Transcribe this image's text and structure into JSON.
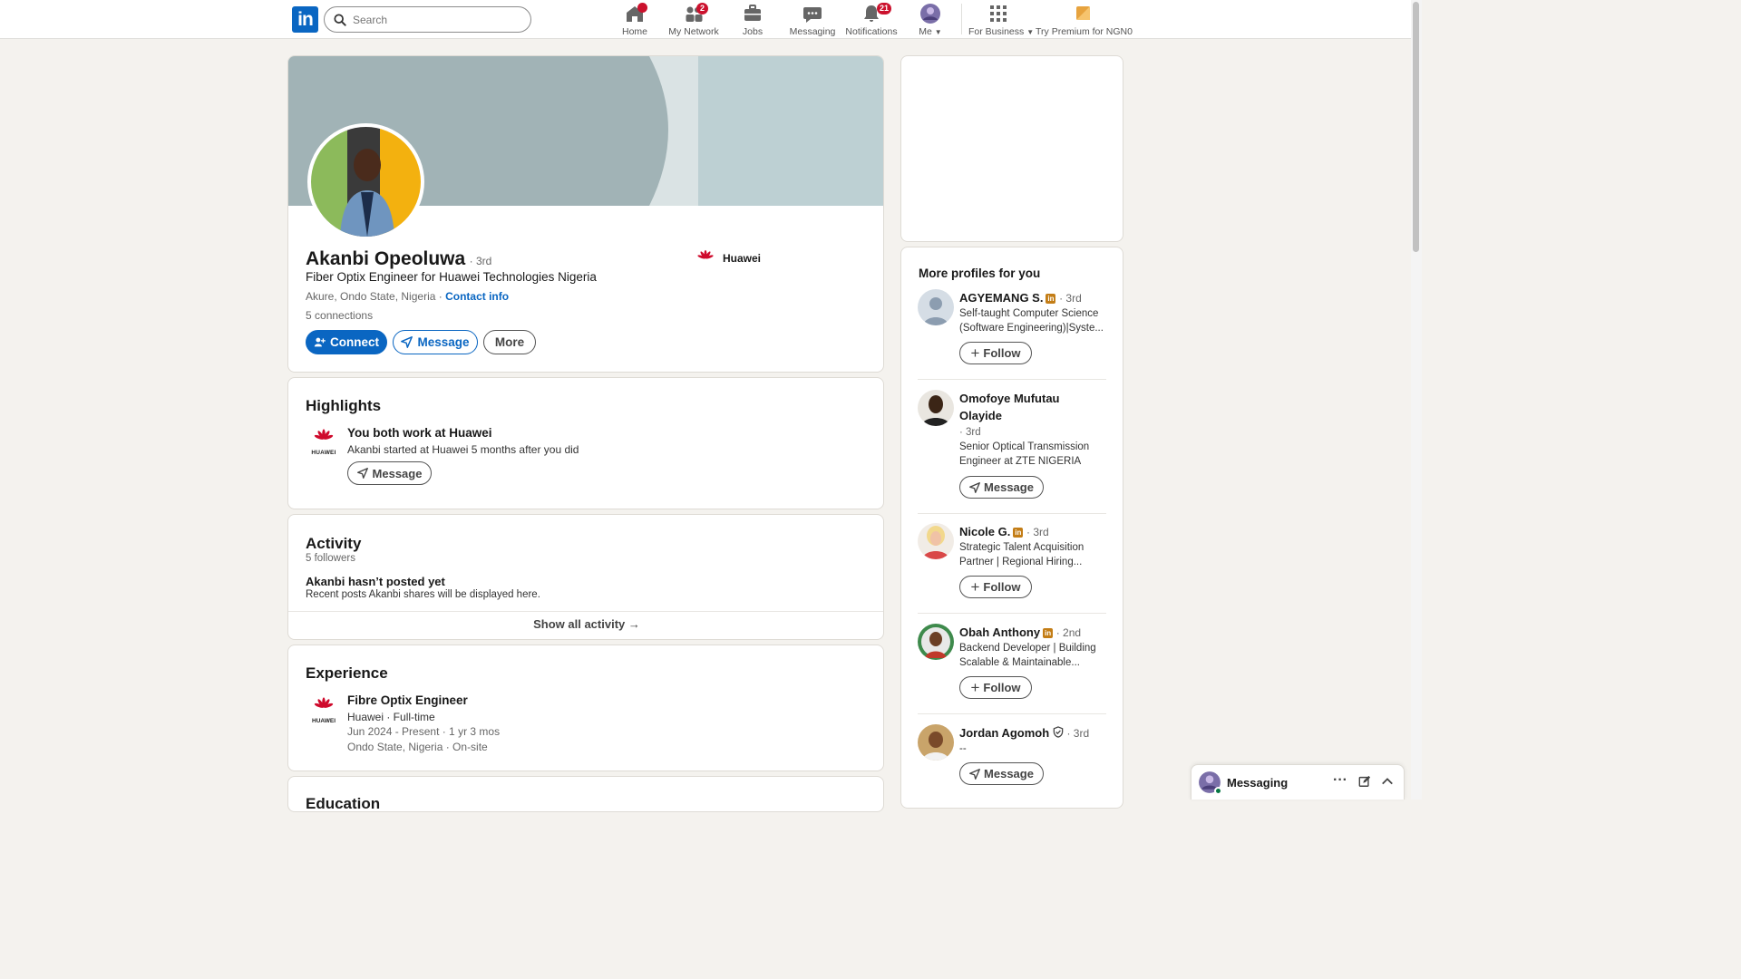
{
  "nav": {
    "search_placeholder": "Search",
    "items": [
      {
        "label": "Home",
        "badge": ""
      },
      {
        "label": "My Network",
        "badge": "2"
      },
      {
        "label": "Jobs",
        "badge": ""
      },
      {
        "label": "Messaging",
        "badge": ""
      },
      {
        "label": "Notifications",
        "badge": "21"
      },
      {
        "label": "Me"
      },
      {
        "label": "For Business"
      },
      {
        "label": "Try Premium for NGN0"
      }
    ],
    "logo": "in"
  },
  "profile": {
    "name": "Akanbi Opeoluwa",
    "degree": "· 3rd",
    "headline": "Fiber Optix Engineer for Huawei Technologies Nigeria",
    "location": "Akure, Ondo State, Nigeria ·",
    "contact_info": "Contact info",
    "connections_count": "5",
    "connections_label": "connections",
    "company": "Huawei",
    "buttons": {
      "connect": "Connect",
      "message": "Message",
      "more": "More"
    }
  },
  "highlights": {
    "title": "Highlights",
    "item_title": "You both work at Huawei",
    "item_desc": "Akanbi started at Huawei 5 months after you did",
    "button": "Message",
    "logo_text": "HUAWEI"
  },
  "activity": {
    "title": "Activity",
    "followers": "5 followers",
    "empty_title": "Akanbi hasn’t posted yet",
    "empty_desc": "Recent posts Akanbi shares will be displayed here.",
    "show_all": "Show all activity"
  },
  "experience": {
    "title": "Experience",
    "role": "Fibre Optix Engineer",
    "company_line": "Huawei · Full-time",
    "dates": "Jun 2024 - Present · 1 yr 3 mos",
    "location": "Ondo State, Nigeria · On-site",
    "logo_text": "HUAWEI"
  },
  "next_section_title": "Education",
  "sidebar": {
    "title": "More profiles for you",
    "profiles": [
      {
        "name": "AGYEMANG S.",
        "degree": "· 3rd",
        "desc": "Self-taught Computer Science (Software Engineering)|Syste...",
        "button": "Follow"
      },
      {
        "name": "Omofoye Mufutau Olayide",
        "degree": "· 3rd",
        "desc": "Senior Optical Transmission Engineer at ZTE NIGERIA",
        "button": "Message"
      },
      {
        "name": "Nicole G.",
        "degree": "· 3rd",
        "desc": "Strategic Talent Acquisition Partner | Regional Hiring...",
        "button": "Follow"
      },
      {
        "name": "Obah Anthony",
        "degree": "· 2nd",
        "desc": "Backend Developer | Building Scalable & Maintainable...",
        "button": "Follow"
      },
      {
        "name": "Jordan Agomoh",
        "degree": "· 3rd",
        "desc": "--",
        "button": "Message"
      }
    ]
  },
  "messaging_bar": {
    "label": "Messaging"
  },
  "colors": {
    "brand": "#0a66c2",
    "badge": "#cb112d",
    "huawei_red": "#cf0a2c",
    "premium_gold": "#e7a33e"
  }
}
